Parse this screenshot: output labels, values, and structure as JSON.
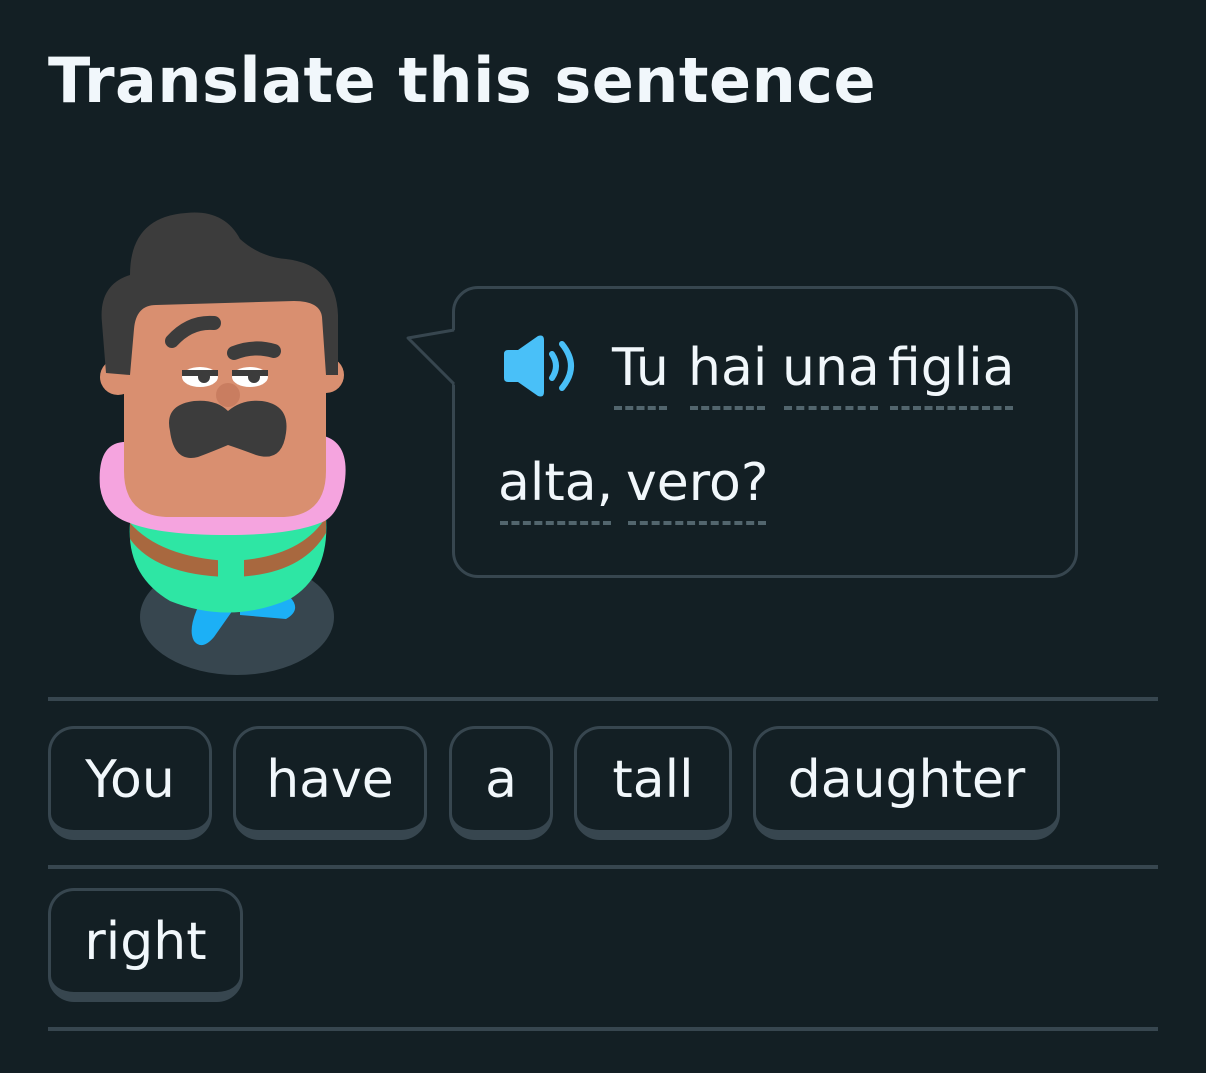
{
  "header": {
    "title": "Translate this sentence"
  },
  "prompt": {
    "audio_icon": "speaker-icon",
    "words": [
      {
        "text": "Tu"
      },
      {
        "text": "hai"
      },
      {
        "text": "una"
      },
      {
        "text": "figlia"
      },
      {
        "text": "alta,"
      },
      {
        "text": "vero?"
      }
    ]
  },
  "word_bank": {
    "tiles": [
      {
        "label": "You"
      },
      {
        "label": "have"
      },
      {
        "label": "a"
      },
      {
        "label": "tall"
      },
      {
        "label": "daughter"
      },
      {
        "label": "right"
      }
    ]
  },
  "colors": {
    "background": "#131f24",
    "border": "#37464f",
    "text": "#f1f7fb",
    "speaker": "#49c0f8"
  }
}
